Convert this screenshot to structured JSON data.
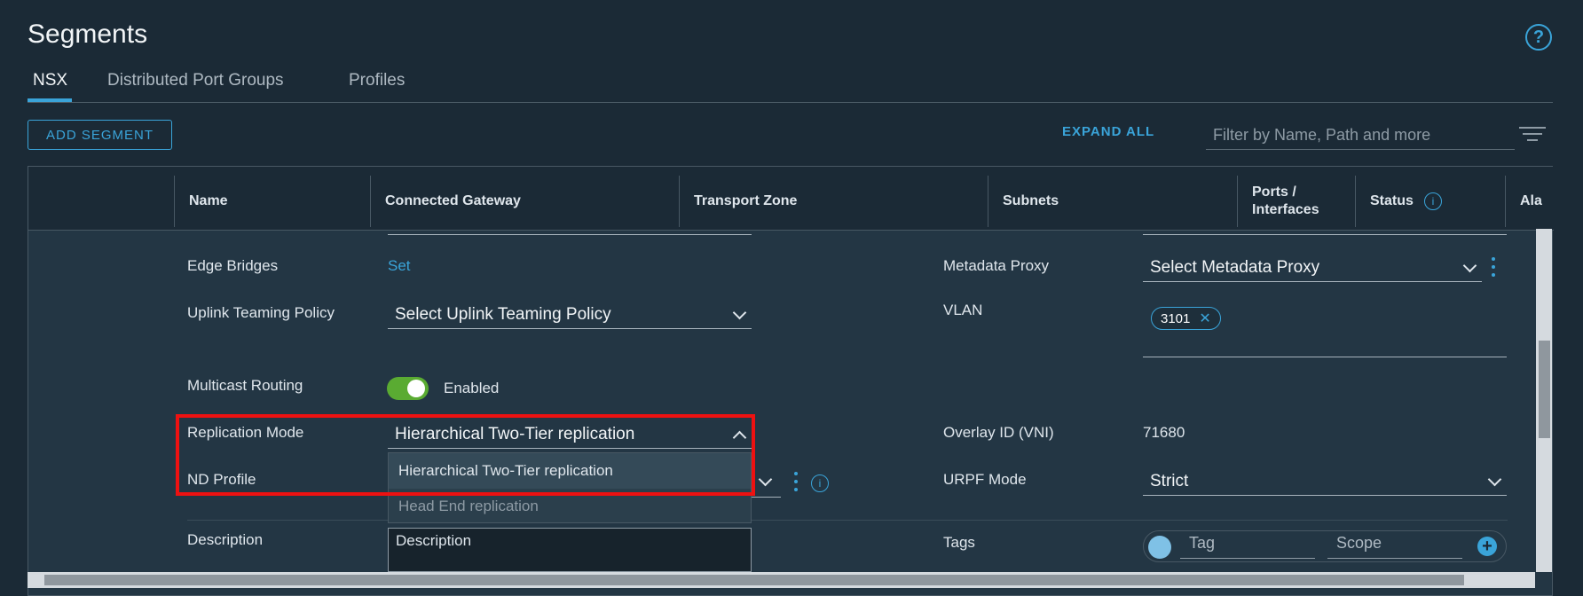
{
  "page": {
    "title": "Segments"
  },
  "tabs": [
    {
      "label": "NSX",
      "active": true
    },
    {
      "label": "Distributed Port Groups",
      "active": false
    },
    {
      "label": "Profiles",
      "active": false
    }
  ],
  "toolbar": {
    "add_segment": "ADD SEGMENT",
    "expand_all": "EXPAND ALL",
    "filter_placeholder": "Filter by Name, Path and more"
  },
  "columns": [
    "Name",
    "Connected Gateway",
    "Transport Zone",
    "Subnets",
    "Ports / Interfaces",
    "Status",
    "Ala"
  ],
  "form": {
    "edge_bridges": {
      "label": "Edge Bridges",
      "value": "Set"
    },
    "uplink_teaming": {
      "label": "Uplink Teaming Policy",
      "value": "Select Uplink Teaming Policy"
    },
    "multicast": {
      "label": "Multicast Routing",
      "state": "Enabled"
    },
    "replication": {
      "label": "Replication Mode",
      "value": "Hierarchical Two-Tier replication",
      "options": [
        "Hierarchical Two-Tier replication",
        "Head End replication"
      ]
    },
    "nd_profile": {
      "label": "ND Profile"
    },
    "description": {
      "label": "Description",
      "placeholder": "Description"
    },
    "metadata_proxy": {
      "label": "Metadata Proxy",
      "value": "Select Metadata Proxy"
    },
    "vlan": {
      "label": "VLAN",
      "chip": "3101"
    },
    "overlay_id": {
      "label": "Overlay ID (VNI)",
      "value": "71680"
    },
    "urpf": {
      "label": "URPF Mode",
      "value": "Strict"
    },
    "tags": {
      "label": "Tags",
      "tag_placeholder": "Tag",
      "scope_placeholder": "Scope"
    }
  },
  "icons": {
    "help": "question-circle-icon",
    "filter": "filter-lines-icon",
    "info": "info-circle-icon",
    "tag": "tag-icon",
    "add": "plus-circle-icon"
  },
  "colors": {
    "accent": "#3aa4d9",
    "toggle_on": "#5aab32",
    "highlight": "#ee1111",
    "background": "#1b2a36"
  }
}
